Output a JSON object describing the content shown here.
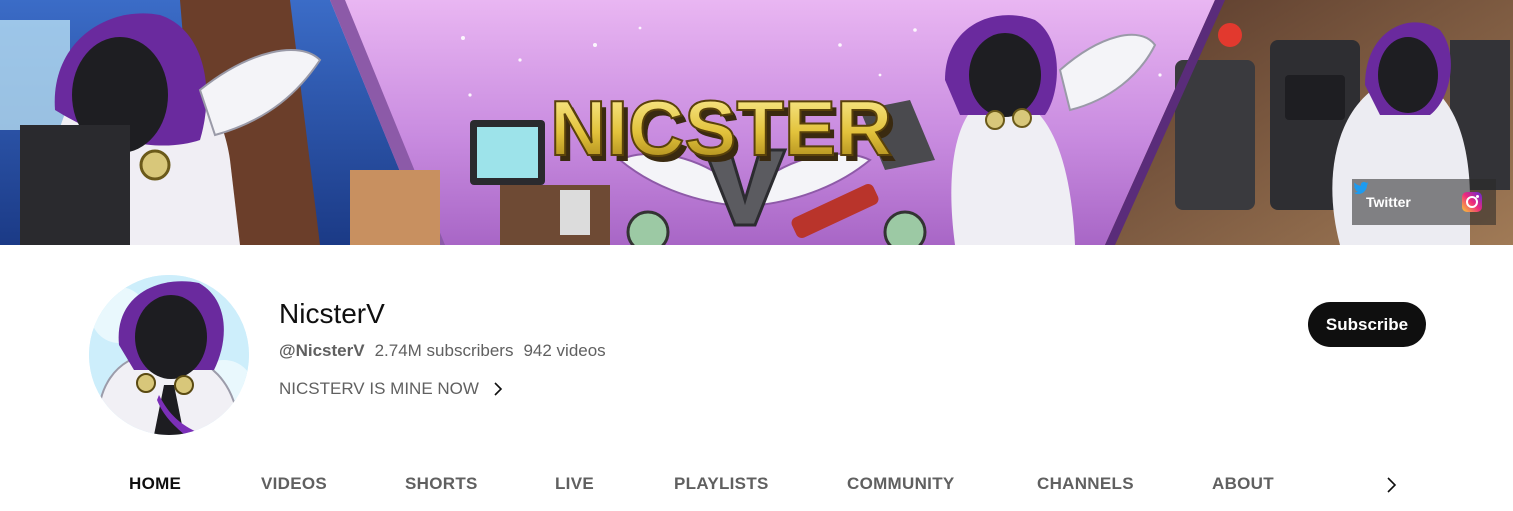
{
  "banner": {
    "title_art": "NICSTER",
    "links": [
      {
        "label": "Twitter",
        "icon": "twitter-icon"
      },
      {
        "label": "",
        "icon": "instagram-icon"
      }
    ]
  },
  "channel": {
    "name": "NicsterV",
    "handle": "@NicsterV",
    "subscribers": "2.74M subscribers",
    "videos": "942 videos",
    "description": "NICSTERV IS MINE NOW",
    "subscribe_label": "Subscribe"
  },
  "tabs": [
    {
      "label": "HOME",
      "active": true
    },
    {
      "label": "VIDEOS",
      "active": false
    },
    {
      "label": "SHORTS",
      "active": false
    },
    {
      "label": "LIVE",
      "active": false
    },
    {
      "label": "PLAYLISTS",
      "active": false
    },
    {
      "label": "COMMUNITY",
      "active": false
    },
    {
      "label": "CHANNELS",
      "active": false
    },
    {
      "label": "ABOUT",
      "active": false
    }
  ],
  "colors": {
    "accent_purple": "#7b2fb8",
    "title_gold": "#e2c23b",
    "subscribe_bg": "#0f0f0f",
    "text_secondary": "#606060"
  }
}
